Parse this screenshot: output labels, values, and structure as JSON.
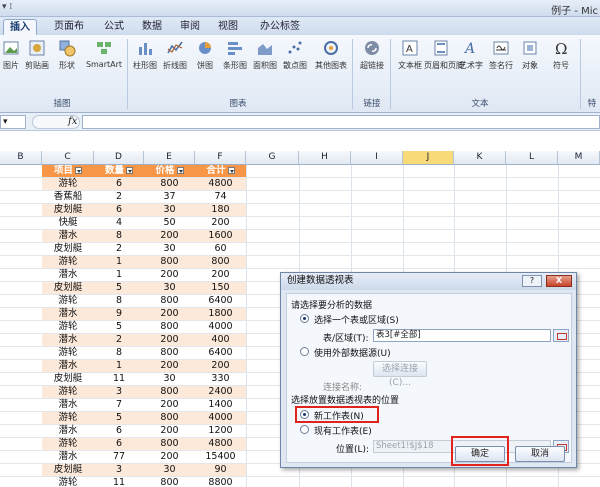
{
  "window": {
    "title": "例子 - Mic"
  },
  "tabs": [
    "插入",
    "页面布局",
    "公式",
    "数据",
    "审阅",
    "视图",
    "办公标签"
  ],
  "ribbon": {
    "groups": [
      {
        "label": "插图",
        "buttons": [
          "图片",
          "剪贴画",
          "形状",
          "SmartArt"
        ]
      },
      {
        "label": "图表",
        "buttons": [
          "柱形图",
          "折线图",
          "饼图",
          "条形图",
          "面积图",
          "散点图",
          "其他图表"
        ]
      },
      {
        "label": "链接",
        "buttons": [
          "超链接"
        ]
      },
      {
        "label": "文本",
        "buttons": [
          "文本框",
          "页眉和页脚",
          "艺术字",
          "签名行",
          "对象",
          "符号"
        ]
      },
      {
        "label": "特"
      }
    ],
    "headerfooter_label_line2": "页脚"
  },
  "formula_bar": {
    "fx": "fx",
    "value": ""
  },
  "columns": [
    "B",
    "C",
    "D",
    "E",
    "F",
    "G",
    "H",
    "I",
    "J",
    "K",
    "L",
    "M"
  ],
  "table": {
    "headers": [
      "项目",
      "数量",
      "价格",
      "合计"
    ],
    "rows": [
      [
        "游轮",
        "6",
        "800",
        "4800"
      ],
      [
        "香蕉船",
        "2",
        "37",
        "74"
      ],
      [
        "皮划艇",
        "6",
        "30",
        "180"
      ],
      [
        "快艇",
        "4",
        "50",
        "200"
      ],
      [
        "潜水",
        "8",
        "200",
        "1600"
      ],
      [
        "皮划艇",
        "2",
        "30",
        "60"
      ],
      [
        "游轮",
        "1",
        "800",
        "800"
      ],
      [
        "潜水",
        "1",
        "200",
        "200"
      ],
      [
        "皮划艇",
        "5",
        "30",
        "150"
      ],
      [
        "游轮",
        "8",
        "800",
        "6400"
      ],
      [
        "潜水",
        "9",
        "200",
        "1800"
      ],
      [
        "游轮",
        "5",
        "800",
        "4000"
      ],
      [
        "潜水",
        "2",
        "200",
        "400"
      ],
      [
        "游轮",
        "8",
        "800",
        "6400"
      ],
      [
        "潜水",
        "1",
        "200",
        "200"
      ],
      [
        "皮划艇",
        "11",
        "30",
        "330"
      ],
      [
        "游轮",
        "3",
        "800",
        "2400"
      ],
      [
        "潜水",
        "7",
        "200",
        "1400"
      ],
      [
        "游轮",
        "5",
        "800",
        "4000"
      ],
      [
        "潜水",
        "6",
        "200",
        "1200"
      ],
      [
        "游轮",
        "6",
        "800",
        "4800"
      ],
      [
        "潜水",
        "77",
        "200",
        "15400"
      ],
      [
        "皮划艇",
        "3",
        "30",
        "90"
      ],
      [
        "游轮",
        "11",
        "800",
        "8800"
      ]
    ]
  },
  "dialog": {
    "title": "创建数据透视表",
    "help": "?",
    "close": "X",
    "section1": "请选择要分析的数据",
    "opt_range": "选择一个表或区域(S)",
    "range_label": "表/区域(T):",
    "range_value": "表3[#全部]",
    "opt_external": "使用外部数据源(U)",
    "choose_conn": "选择连接(C)...",
    "conn_name": "连接名称:",
    "section2": "选择放置数据透视表的位置",
    "opt_new": "新工作表(N)",
    "opt_existing": "现有工作表(E)",
    "location_label": "位置(L):",
    "location_value": "Sheet1!$J$18",
    "ok": "确定",
    "cancel": "取消"
  }
}
